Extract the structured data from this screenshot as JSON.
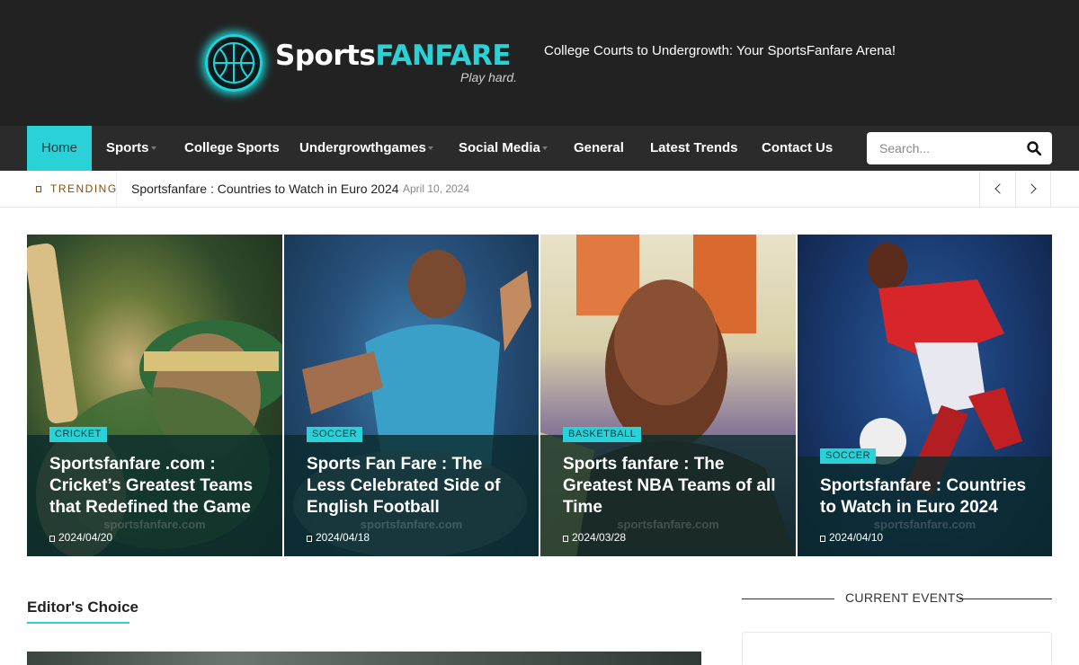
{
  "header": {
    "logo": {
      "text_main": "Sports",
      "text_accent": "FANFARE",
      "tag": "Play hard."
    },
    "tagline": "College Courts to Undergrowth: Your SportsFanfare Arena!"
  },
  "nav": {
    "items": [
      {
        "label": "Home",
        "active": true,
        "dropdown": false
      },
      {
        "label": "Sports",
        "active": false,
        "dropdown": true
      },
      {
        "label": "College Sports",
        "active": false,
        "dropdown": false
      },
      {
        "label": "Undergrowthgames",
        "active": false,
        "dropdown": true
      },
      {
        "label": "Social Media",
        "active": false,
        "dropdown": true
      },
      {
        "label": "General",
        "active": false,
        "dropdown": false
      },
      {
        "label": "Latest Trends",
        "active": false,
        "dropdown": false
      },
      {
        "label": "Contact Us",
        "active": false,
        "dropdown": false
      }
    ],
    "search": {
      "placeholder": "Search...",
      "icon": "search-icon"
    }
  },
  "trending": {
    "label": "TRENDING",
    "title": "Sportsfanfare : Countries to Watch in Euro 2024",
    "date": "April 10, 2024"
  },
  "featured": [
    {
      "category": "CRICKET",
      "title": "Sportsfanfare .com : Cricket’s Greatest Teams that Redefined the Game",
      "date": "2024/04/20",
      "watermark": "sportsfanfare.com"
    },
    {
      "category": "SOCCER",
      "title": "Sports Fan Fare : The Less Celebrated Side of English Football",
      "date": "2024/04/18",
      "watermark": "sportsfanfare.com"
    },
    {
      "category": "BASKETBALL",
      "title": "Sports fanfare : The Greatest NBA Teams of all Time",
      "date": "2024/03/28",
      "watermark": "sportsfanfare.com"
    },
    {
      "category": "SOCCER",
      "title": "Sportsfanfare : Countries to Watch in Euro 2024",
      "date": "2024/04/10",
      "watermark": "sportsfanfare.com"
    }
  ],
  "editors_choice": {
    "title": "Editor's Choice"
  },
  "sidebar": {
    "current_events_title": "CURRENT EVENTS"
  },
  "colors": {
    "accent": "#2ad2d8",
    "header_bg": "#222222",
    "nav_bg": "#2b2b2b",
    "trending_label": "#8a4b10"
  }
}
